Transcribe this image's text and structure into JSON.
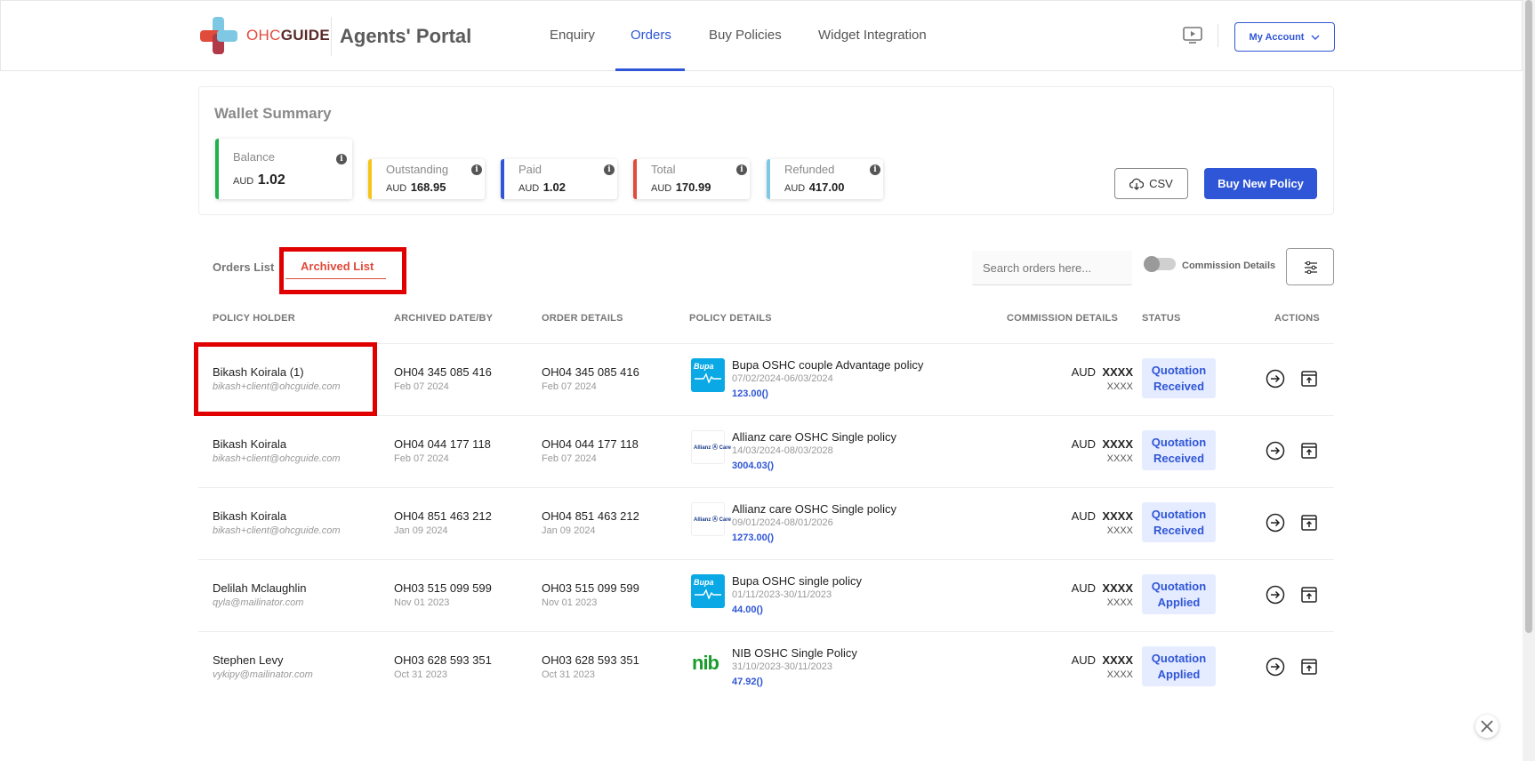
{
  "header": {
    "logo_text_a": "OHC",
    "logo_text_b": "GUIDE",
    "portal_title": "Agents' Portal",
    "nav": [
      {
        "label": "Enquiry"
      },
      {
        "label": "Orders",
        "active": true
      },
      {
        "label": "Buy Policies"
      },
      {
        "label": "Widget Integration"
      }
    ],
    "account_label": "My Account"
  },
  "wallet": {
    "title": "Wallet Summary",
    "cards": [
      {
        "label": "Balance",
        "currency": "AUD",
        "value": "1.02",
        "color": "#22b14c"
      },
      {
        "label": "Outstanding",
        "currency": "AUD",
        "value": "168.95",
        "color": "#f5c518"
      },
      {
        "label": "Paid",
        "currency": "AUD",
        "value": "1.02",
        "color": "#2f56d6"
      },
      {
        "label": "Total",
        "currency": "AUD",
        "value": "170.99",
        "color": "#e14b3b"
      },
      {
        "label": "Refunded",
        "currency": "AUD",
        "value": "417.00",
        "color": "#7ec8e3"
      }
    ],
    "csv_label": "CSV",
    "buy_label": "Buy New Policy"
  },
  "tabs": {
    "orders_list": "Orders List",
    "archived_list": "Archived List"
  },
  "search": {
    "placeholder": "Search orders here..."
  },
  "commission_toggle_label": "Commission Details",
  "table": {
    "headers": {
      "holder": "POLICY HOLDER",
      "archived": "ARCHIVED DATE/BY",
      "order": "ORDER DETAILS",
      "policy": "POLICY DETAILS",
      "commission": "COMMISSION DETAILS",
      "status": "STATUS",
      "actions": "ACTIONS"
    },
    "rows": [
      {
        "name": "Bikash Koirala (1)",
        "email": "bikash+client@ohcguide.com",
        "archived_no": "OH04 345 085 416",
        "archived_date": "Feb 07 2024",
        "order_no": "OH04 345 085 416",
        "order_date": "Feb 07 2024",
        "insurer": "bupa",
        "policy": "Bupa OSHC couple Advantage policy",
        "policy_dates": "07/02/2024-06/03/2024",
        "amount": "123.00()",
        "com_currency": "AUD",
        "com_value": "XXXX",
        "com_sub": "XXXX",
        "status_line1": "Quotation",
        "status_line2": "Received"
      },
      {
        "name": "Bikash Koirala",
        "email": "bikash+client@ohcguide.com",
        "archived_no": "OH04 044 177 118",
        "archived_date": "Feb 07 2024",
        "order_no": "OH04 044 177 118",
        "order_date": "Feb 07 2024",
        "insurer": "allianz",
        "policy": "Allianz care OSHC Single policy",
        "policy_dates": "14/03/2024-08/03/2028",
        "amount": "3004.03()",
        "com_currency": "AUD",
        "com_value": "XXXX",
        "com_sub": "XXXX",
        "status_line1": "Quotation",
        "status_line2": "Received"
      },
      {
        "name": "Bikash Koirala",
        "email": "bikash+client@ohcguide.com",
        "archived_no": "OH04 851 463 212",
        "archived_date": "Jan 09 2024",
        "order_no": "OH04 851 463 212",
        "order_date": "Jan 09 2024",
        "insurer": "allianz",
        "policy": "Allianz care OSHC Single policy",
        "policy_dates": "09/01/2024-08/01/2026",
        "amount": "1273.00()",
        "com_currency": "AUD",
        "com_value": "XXXX",
        "com_sub": "XXXX",
        "status_line1": "Quotation",
        "status_line2": "Received"
      },
      {
        "name": "Delilah Mclaughlin",
        "email": "qyla@mailinator.com",
        "archived_no": "OH03 515 099 599",
        "archived_date": "Nov 01 2023",
        "order_no": "OH03 515 099 599",
        "order_date": "Nov 01 2023",
        "insurer": "bupa",
        "policy": "Bupa OSHC single policy",
        "policy_dates": "01/11/2023-30/11/2023",
        "amount": "44.00()",
        "com_currency": "AUD",
        "com_value": "XXXX",
        "com_sub": "XXXX",
        "status_line1": "Quotation",
        "status_line2": "Applied"
      },
      {
        "name": "Stephen Levy",
        "email": "vykipy@mailinator.com",
        "archived_no": "OH03 628 593 351",
        "archived_date": "Oct 31 2023",
        "order_no": "OH03 628 593 351",
        "order_date": "Oct 31 2023",
        "insurer": "nib",
        "policy": "NIB OSHC Single Policy",
        "policy_dates": "31/10/2023-30/11/2023",
        "amount": "47.92()",
        "com_currency": "AUD",
        "com_value": "XXXX",
        "com_sub": "XXXX",
        "status_line1": "Quotation",
        "status_line2": "Applied"
      }
    ]
  },
  "logos": {
    "bupa_text": "Bupa",
    "allianz_text": "Allianz Ⓐ Care",
    "nib_text": "nib"
  },
  "colors": {
    "primary": "#2f56d6",
    "accent_red": "#e14b3b",
    "highlight_box": "#e00000"
  }
}
